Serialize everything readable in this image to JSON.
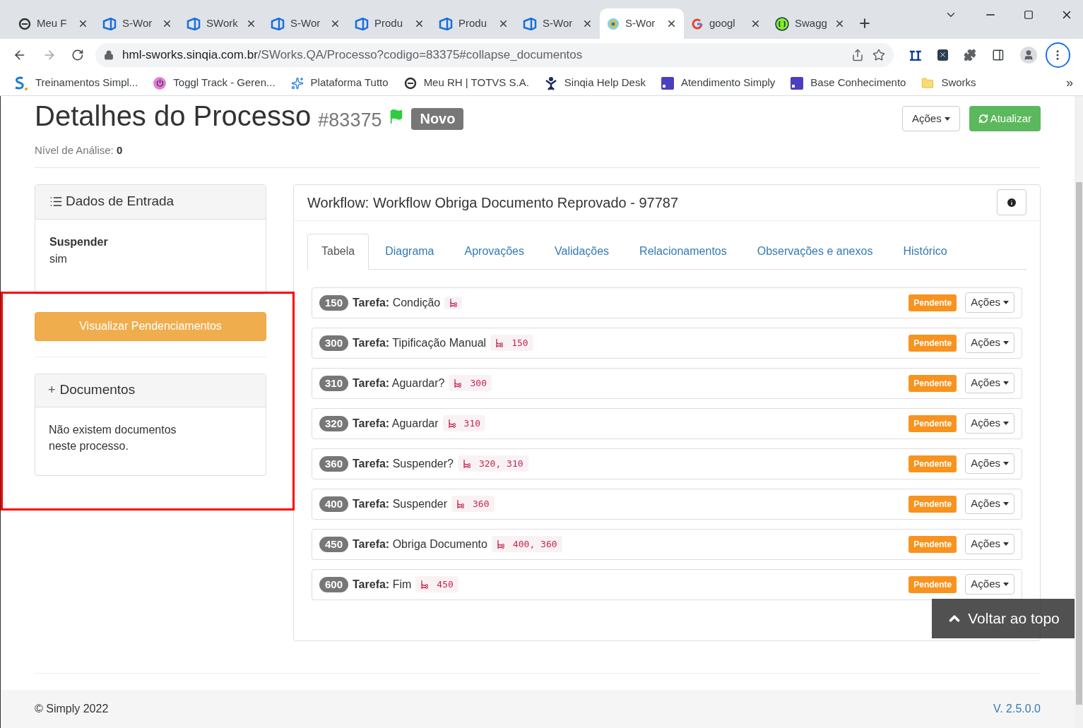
{
  "browser": {
    "tabs": [
      {
        "label": "Meu F",
        "kind": "circle",
        "selected": false
      },
      {
        "label": "S-Wor",
        "kind": "azure",
        "selected": false
      },
      {
        "label": "SWork",
        "kind": "azure",
        "selected": false
      },
      {
        "label": "S-Wor",
        "kind": "azure",
        "selected": false
      },
      {
        "label": "Produ",
        "kind": "azure",
        "selected": false
      },
      {
        "label": "Produ",
        "kind": "azure",
        "selected": false
      },
      {
        "label": "S-Wor",
        "kind": "azure",
        "selected": false
      },
      {
        "label": "S-Wor",
        "kind": "target",
        "selected": true
      },
      {
        "label": "googl",
        "kind": "google",
        "selected": false
      },
      {
        "label": "Swagg",
        "kind": "swagger",
        "selected": false
      }
    ],
    "url": {
      "host": "hml-sworks.sinqia.com.br",
      "path": "/SWorks.QA/Processo?codigo=83375#collapse_documentos"
    },
    "bookmarks": [
      {
        "label": "Treinamentos Simpl...",
        "kind": "s-logo"
      },
      {
        "label": "Toggl Track - Geren...",
        "kind": "power"
      },
      {
        "label": "Plataforma Tutto",
        "kind": "spark"
      },
      {
        "label": "Meu RH | TOTVS S.A.",
        "kind": "circle"
      },
      {
        "label": "Sinqia Help Desk",
        "kind": "person"
      },
      {
        "label": "Atendimento Simply",
        "kind": "square-s"
      },
      {
        "label": "Base Conhecimento",
        "kind": "square-s"
      },
      {
        "label": "Sworks",
        "kind": "folder"
      }
    ],
    "overflow": "»"
  },
  "header": {
    "title": "Detalhes do Processo",
    "number": "#83375",
    "status": "Novo",
    "analysis_label": "Nível de Análise:",
    "analysis_value": "0",
    "actions_button": "Ações",
    "refresh_button": "Atualizar"
  },
  "input_panel": {
    "title": "Dados de Entrada",
    "field_label": "Suspender",
    "field_value": "sim"
  },
  "pending_button": "Visualizar Pendenciamentos",
  "documents_panel": {
    "toggle": "+",
    "title": "Documentos",
    "message": "Não existem documentos neste processo."
  },
  "workflow": {
    "title": "Workflow: Workflow Obriga Documento Reprovado - 97787",
    "tabs": [
      {
        "label": "Tabela",
        "selected": true
      },
      {
        "label": "Diagrama",
        "selected": false
      },
      {
        "label": "Aprovações",
        "selected": false
      },
      {
        "label": "Validações",
        "selected": false
      },
      {
        "label": "Relacionamentos",
        "selected": false
      },
      {
        "label": "Observações e anexos",
        "selected": false
      },
      {
        "label": "Histórico",
        "selected": false
      }
    ],
    "tasks": [
      {
        "id": "150",
        "prefix": "Tarefa:",
        "name": "Condição",
        "status": "Pendente",
        "actions": "Ações"
      },
      {
        "id": "300",
        "prefix": "Tarefa:",
        "name": "Tipificação Manual",
        "deps": "150",
        "status": "Pendente",
        "actions": "Ações"
      },
      {
        "id": "310",
        "prefix": "Tarefa:",
        "name": "Aguardar?",
        "deps": "300",
        "status": "Pendente",
        "actions": "Ações"
      },
      {
        "id": "320",
        "prefix": "Tarefa:",
        "name": "Aguardar",
        "deps": "310",
        "status": "Pendente",
        "actions": "Ações"
      },
      {
        "id": "360",
        "prefix": "Tarefa:",
        "name": "Suspender?",
        "deps": "320, 310",
        "status": "Pendente",
        "actions": "Ações"
      },
      {
        "id": "400",
        "prefix": "Tarefa:",
        "name": "Suspender",
        "deps": "360",
        "status": "Pendente",
        "actions": "Ações"
      },
      {
        "id": "450",
        "prefix": "Tarefa:",
        "name": "Obriga Documento",
        "deps": "400, 360",
        "status": "Pendente",
        "actions": "Ações"
      },
      {
        "id": "600",
        "prefix": "Tarefa:",
        "name": "Fim",
        "deps": "450",
        "status": "Pendente",
        "actions": "Ações"
      }
    ]
  },
  "back_to_top": "Voltar ao topo",
  "footer": {
    "copyright": "© Simply 2022",
    "version": "V. 2.5.0.0"
  }
}
